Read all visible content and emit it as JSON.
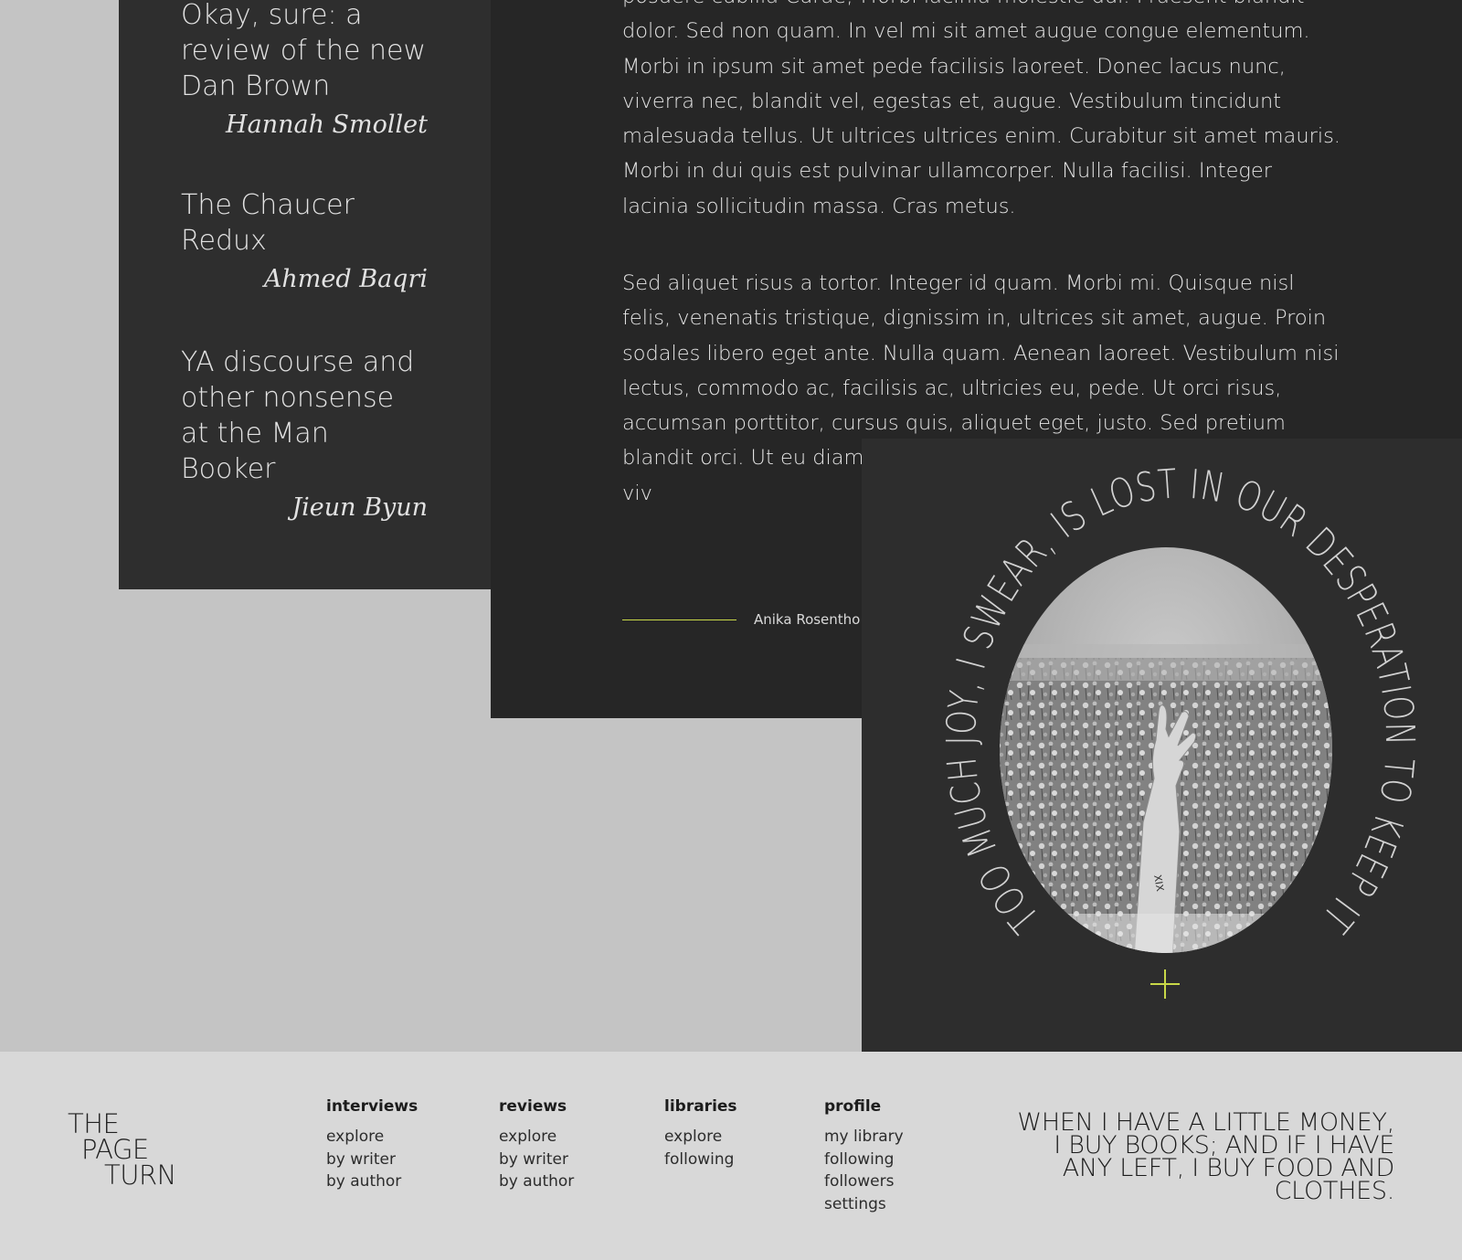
{
  "sidebar": {
    "entries": [
      {
        "title": "Okay, sure: a review of the new Dan Brown",
        "author": "Hannah Smollet"
      },
      {
        "title": "The Chaucer Redux",
        "author": "Ahmed Baqri"
      },
      {
        "title": "YA discourse and other nonsense at the Man Booker",
        "author": "Jieun Byun"
      }
    ]
  },
  "article": {
    "paragraph_1": "posuere cubilia Curae; Morbi lacinia molestie dui. Praesent blandit dolor. Sed non quam. In vel mi sit amet augue congue elementum. Morbi in ipsum sit amet pede facilisis laoreet. Donec lacus nunc, viverra nec, blandit vel, egestas et, augue. Vestibulum tincidunt malesuada tellus. Ut ultrices ultrices enim. Curabitur sit amet mauris. Morbi in dui quis est pulvinar ullamcorper. Nulla facilisi. Integer lacinia sollicitudin massa. Cras metus.",
    "paragraph_2": "Sed aliquet risus a tortor. Integer id quam. Morbi mi. Quisque nisl felis, venenatis tristique, dignissim in, ultrices sit amet, augue. Proin sodales libero eget ante. Nulla quam. Aenean laoreet. Vestibulum nisi lectus, commodo ac, facilisis ac, ultricies eu, pede. Ut orci risus, accumsan porttitor, cursus quis, aliquet eget, justo. Sed pretium blandit orci. Ut eu diam fermentum non, conval aliquet et, iaculis et, viv",
    "byline": "Anika Rosentho"
  },
  "promo": {
    "circular_quote": "TOO MUCH JOY, I SWEAR, IS LOST IN OUR DESPERATION TO KEEP IT",
    "image_alt": "black and white photo of a hand raised out of a flower field",
    "tattoo": "XIX",
    "accent_color": "#c8d848"
  },
  "footer": {
    "logo": {
      "line1": "THE",
      "line2": "PAGE",
      "line3": "TURN"
    },
    "columns": [
      {
        "heading": "interviews",
        "links": [
          "explore",
          "by writer",
          "by author"
        ]
      },
      {
        "heading": "reviews",
        "links": [
          "explore",
          "by writer",
          "by author"
        ]
      },
      {
        "heading": "libraries",
        "links": [
          "explore",
          "following"
        ]
      },
      {
        "heading": "profile",
        "links": [
          "my library",
          "following",
          "followers",
          "settings"
        ]
      }
    ],
    "quote": "WHEN I HAVE A LITTLE MONEY, I BUY BOOKS; AND IF I HAVE ANY LEFT, I BUY FOOD  AND CLOTHES."
  }
}
